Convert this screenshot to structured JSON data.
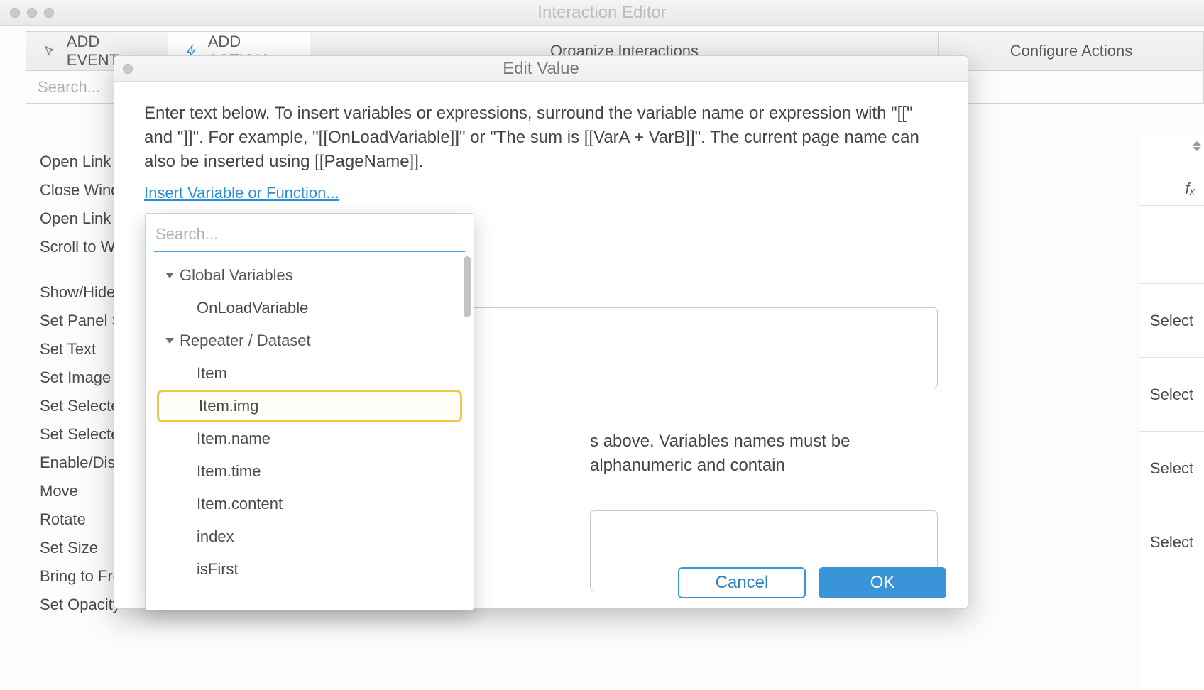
{
  "outer": {
    "title": "Interaction Editor"
  },
  "tabs": {
    "add_event": "ADD EVENT",
    "add_action": "ADD ACTION",
    "organize": "Organize Interactions",
    "configure": "Configure Actions"
  },
  "search": {
    "placeholder": "Search..."
  },
  "actions": {
    "items": [
      "Open Link",
      "Close Window",
      "Open Link in Frame",
      "Scroll to Widget",
      "Show/Hide",
      "Set Panel State",
      "Set Text",
      "Set Image",
      "Set Selected/Checked",
      "Set Selected List Option",
      "Enable/Disable",
      "Move",
      "Rotate",
      "Set Size",
      "Bring to Front/Back",
      "Set Opacity"
    ]
  },
  "right_rail": {
    "fx": "fₓ",
    "select": "Select"
  },
  "modal": {
    "title": "Edit Value",
    "desc": "Enter text below. To insert variables or expressions, surround the variable name or expression with \"[[\" and \"]]\". For example, \"[[OnLoadVariable]]\" or \"The sum is [[VarA + VarB]]\". The current page name can also be inserted using [[PageName]].",
    "insert_link": "Insert Variable or Function...",
    "footnote": "s above. Variables names must be alphanumeric and contain",
    "ok": "OK",
    "cancel": "Cancel"
  },
  "var_dropdown": {
    "search_placeholder": "Search...",
    "groups": [
      {
        "label": "Global Variables",
        "items": [
          "OnLoadVariable"
        ]
      },
      {
        "label": "Repeater / Dataset",
        "items": [
          "Item",
          "Item.img",
          "Item.name",
          "Item.time",
          "Item.content",
          "index",
          "isFirst"
        ]
      }
    ],
    "highlighted": "Item.img"
  }
}
